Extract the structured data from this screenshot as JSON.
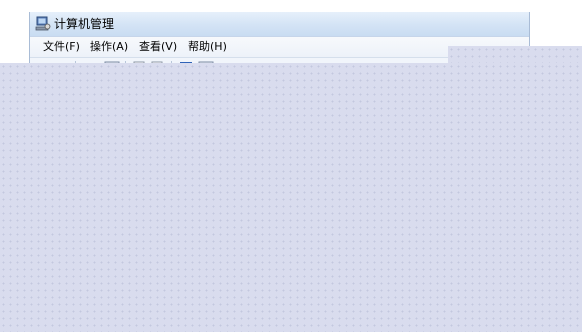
{
  "window": {
    "title": "计算机管理",
    "icon": "computer-management-icon"
  },
  "menubar": {
    "items": [
      {
        "label": "文件(F)"
      },
      {
        "label": "操作(A)"
      },
      {
        "label": "查看(V)"
      },
      {
        "label": "帮助(H)"
      }
    ]
  },
  "toolbar": {
    "buttons": [
      {
        "icon": "back-arrow-icon"
      },
      {
        "icon": "forward-arrow-icon"
      },
      {
        "icon": "up-level-icon"
      },
      {
        "icon": "show-hide-tree-icon"
      },
      {
        "icon": "export-list-icon"
      },
      {
        "icon": "properties-icon"
      },
      {
        "icon": "help-icon"
      },
      {
        "icon": "show-action-pane-icon"
      }
    ]
  },
  "overlay": {
    "color": "#d9dcee",
    "dot_color": "#c3c7df"
  }
}
